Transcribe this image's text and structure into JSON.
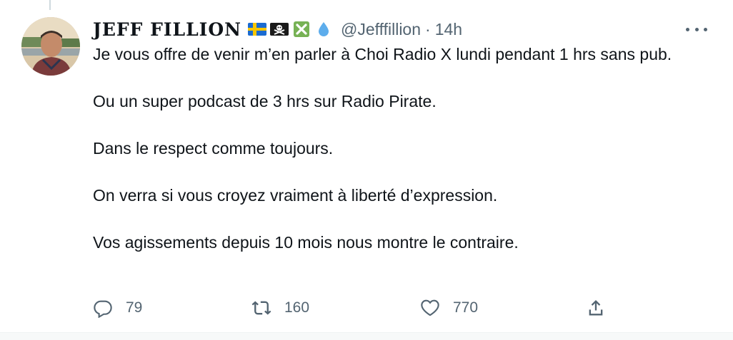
{
  "tweet": {
    "author": {
      "display_name": "JEFF FILLION",
      "handle": "@Jefffillion",
      "emojis": [
        "sweden-flag-icon",
        "pirate-flag-icon",
        "cross-mark-icon",
        "droplet-icon"
      ]
    },
    "separator": "·",
    "time": "14h",
    "paragraphs": [
      "Je vous offre de venir m’en parler à Choi Radio X lundi pendant 1 hrs sans pub.",
      "Ou un super podcast de 3 hrs sur Radio Pirate.",
      "Dans le respect comme toujours.",
      "On verra si vous croyez vraiment à liberté d’expression.",
      "Vos agissements depuis 10 mois nous montre le contraire."
    ],
    "actions": {
      "replies": "79",
      "retweets": "160",
      "likes": "770"
    }
  },
  "colors": {
    "text": "#0f1419",
    "secondary": "#536471",
    "divider": "#eff3f4"
  }
}
